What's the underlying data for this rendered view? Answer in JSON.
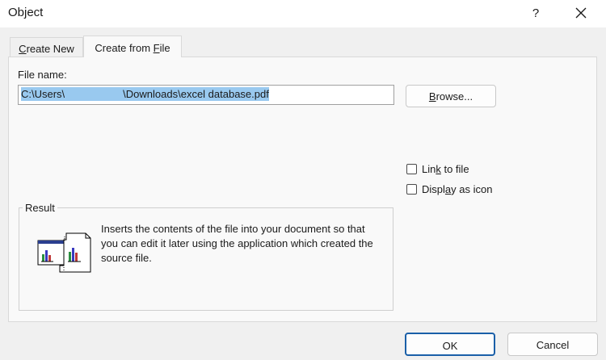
{
  "window": {
    "title": "Object",
    "help_label": "?"
  },
  "tabs": [
    {
      "label_prefix": "",
      "label_underline": "C",
      "label_suffix": "reate New"
    },
    {
      "label_prefix": "Create from ",
      "label_underline": "F",
      "label_suffix": "ile"
    }
  ],
  "file": {
    "label": "File name:",
    "value_part1": "C:\\Users\\",
    "value_part2": "\\Downloads\\excel database.pdf"
  },
  "browse": {
    "underline": "B",
    "rest": "rowse..."
  },
  "options": {
    "link_prefix": "Lin",
    "link_underline": "k",
    "link_suffix": " to file",
    "icon_prefix": "Displ",
    "icon_underline": "a",
    "icon_suffix": "y as icon"
  },
  "result": {
    "legend": "Result",
    "text": "Inserts the contents of the file into your document so that you can edit it later using the application which created the source file."
  },
  "buttons": {
    "ok": "OK",
    "cancel": "Cancel"
  },
  "colors": {
    "selection": "#99c9ef",
    "ok_border": "#1a5fa8"
  }
}
